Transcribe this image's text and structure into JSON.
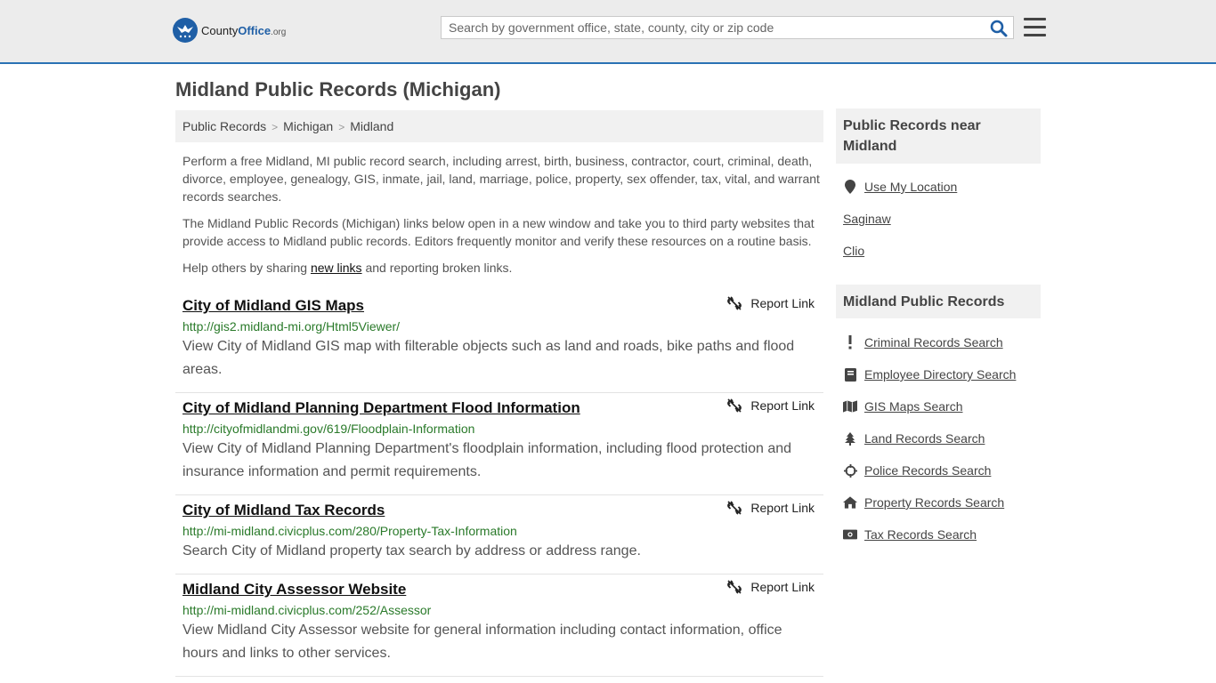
{
  "header": {
    "logo_text_bold": "County",
    "logo_text_blue": "Office",
    "logo_text_org": ".org",
    "search_placeholder": "Search by government office, state, county, city or zip code"
  },
  "page": {
    "title": "Midland Public Records (Michigan)"
  },
  "breadcrumb": [
    "Public Records",
    "Michigan",
    "Midland"
  ],
  "intro": {
    "p1": "Perform a free Midland, MI public record search, including arrest, birth, business, contractor, court, criminal, death, divorce, employee, genealogy, GIS, inmate, jail, land, marriage, police, property, sex offender, tax, vital, and warrant records searches.",
    "p2": "The Midland Public Records (Michigan) links below open in a new window and take you to third party websites that provide access to Midland public records. Editors frequently monitor and verify these resources on a routine basis.",
    "p3_before": "Help others by sharing ",
    "p3_link": "new links",
    "p3_after": " and reporting broken links."
  },
  "report_label": "Report Link",
  "results": [
    {
      "title": "City of Midland GIS Maps",
      "url": "http://gis2.midland-mi.org/Html5Viewer/",
      "desc": "View City of Midland GIS map with filterable objects such as land and roads, bike paths and flood areas."
    },
    {
      "title": "City of Midland Planning Department Flood Information",
      "url": "http://cityofmidlandmi.gov/619/Floodplain-Information",
      "desc": "View City of Midland Planning Department's floodplain information, including flood protection and insurance information and permit requirements."
    },
    {
      "title": "City of Midland Tax Records",
      "url": "http://mi-midland.civicplus.com/280/Property-Tax-Information",
      "desc": "Search City of Midland property tax search by address or address range."
    },
    {
      "title": "Midland City Assessor Website",
      "url": "http://mi-midland.civicplus.com/252/Assessor",
      "desc": "View Midland City Assessor website for general information including contact information, office hours and links to other services."
    }
  ],
  "sidebar": {
    "near_title": "Public Records near Midland",
    "near_items": [
      {
        "label": "Use My Location",
        "icon": "location-pin-icon"
      },
      {
        "label": "Saginaw"
      },
      {
        "label": "Clio"
      }
    ],
    "records_title": "Midland Public Records",
    "records_items": [
      {
        "label": "Criminal Records Search",
        "icon": "exclamation-icon"
      },
      {
        "label": "Employee Directory Search",
        "icon": "book-icon"
      },
      {
        "label": "GIS Maps Search",
        "icon": "map-icon"
      },
      {
        "label": "Land Records Search",
        "icon": "tree-icon"
      },
      {
        "label": "Police Records Search",
        "icon": "crosshair-icon"
      },
      {
        "label": "Property Records Search",
        "icon": "house-icon"
      },
      {
        "label": "Tax Records Search",
        "icon": "money-icon"
      }
    ]
  },
  "colors": {
    "accent": "#2a72b4",
    "url_green": "#2a7a2a"
  }
}
